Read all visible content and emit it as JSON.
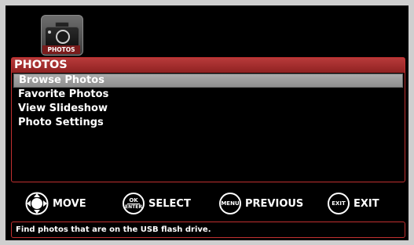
{
  "app": {
    "icon": "camera-icon",
    "label": "PHOTOS"
  },
  "panel": {
    "title": "PHOTOS",
    "items": [
      {
        "label": "Browse Photos",
        "selected": true
      },
      {
        "label": "Favorite Photos",
        "selected": false
      },
      {
        "label": "View Slideshow",
        "selected": false
      },
      {
        "label": "Photo Settings",
        "selected": false
      }
    ]
  },
  "hints": {
    "move": {
      "icon": "dpad-icon",
      "label": "MOVE"
    },
    "select": {
      "icon_top": "OK",
      "icon_bottom": "ENTER",
      "label": "SELECT"
    },
    "previous": {
      "icon_text": "MENU",
      "label": "PREVIOUS"
    },
    "exit": {
      "icon_text": "EXIT",
      "label": "EXIT"
    }
  },
  "status": {
    "text": "Find photos that are on the USB flash drive."
  },
  "colors": {
    "accent": "#b83a3a",
    "selection": "#9e9e9e",
    "background": "#000000"
  }
}
